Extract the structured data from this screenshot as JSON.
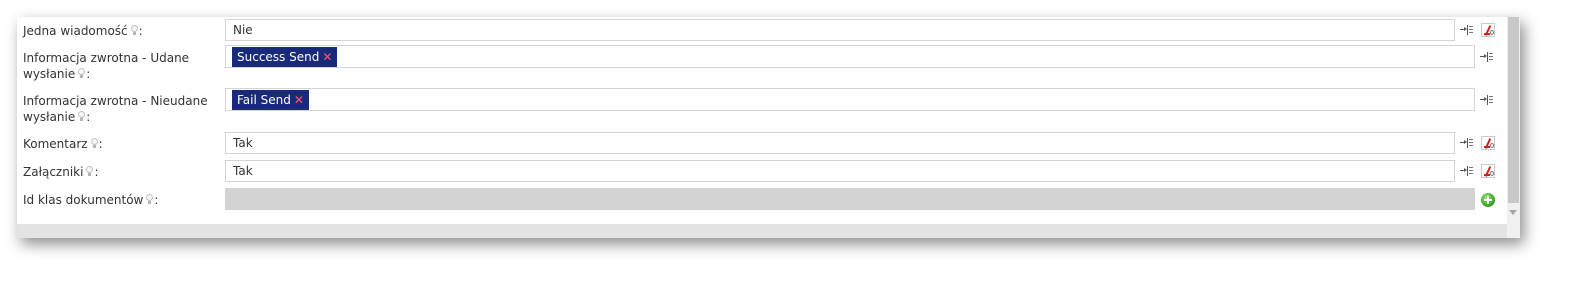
{
  "form": {
    "rows": [
      {
        "label": "Jedna wiadomość",
        "colon": ":",
        "value": "Nie"
      },
      {
        "label_line1": "Informacja zwrotna - Udane",
        "label_line2": "wysłanie",
        "colon": ":",
        "tag": "Success Send",
        "tag_remove": "✕"
      },
      {
        "label_line1": "Informacja zwrotna - Nieudane",
        "label_line2": "wysłanie",
        "colon": ":",
        "tag": "Fail Send",
        "tag_remove": "✕"
      },
      {
        "label": "Komentarz",
        "colon": ":",
        "value": "Tak"
      },
      {
        "label": "Załączniki",
        "colon": ":",
        "value": "Tak"
      },
      {
        "label": "Id klas dokumentów",
        "colon": ":",
        "value": ""
      }
    ]
  },
  "icons": {
    "hint": "lightbulb-icon",
    "map": "variable-map-icon",
    "clear": "clear-value-icon",
    "add": "add-icon"
  },
  "colors": {
    "tag_background": "#1a2a7a",
    "tag_remove": "#ff5a6a",
    "disabled_field": "#d3d3d3",
    "add_icon": "#3fa82c"
  }
}
